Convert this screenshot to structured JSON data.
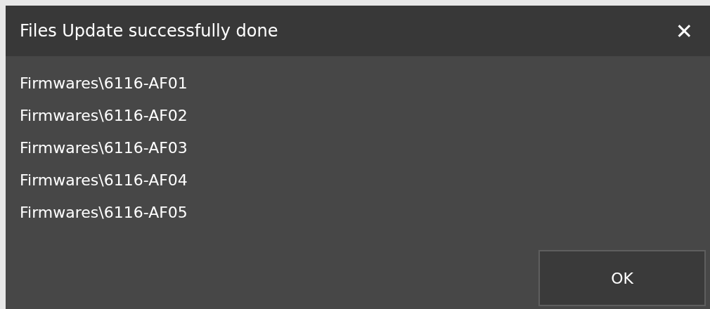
{
  "window": {
    "title": "Files Update successfully done",
    "close": "✕"
  },
  "files": [
    "Firmwares\\6116-AF01",
    "Firmwares\\6116-AF02",
    "Firmwares\\6116-AF03",
    "Firmwares\\6116-AF04",
    "Firmwares\\6116-AF05"
  ],
  "buttons": [
    "OK"
  ]
}
